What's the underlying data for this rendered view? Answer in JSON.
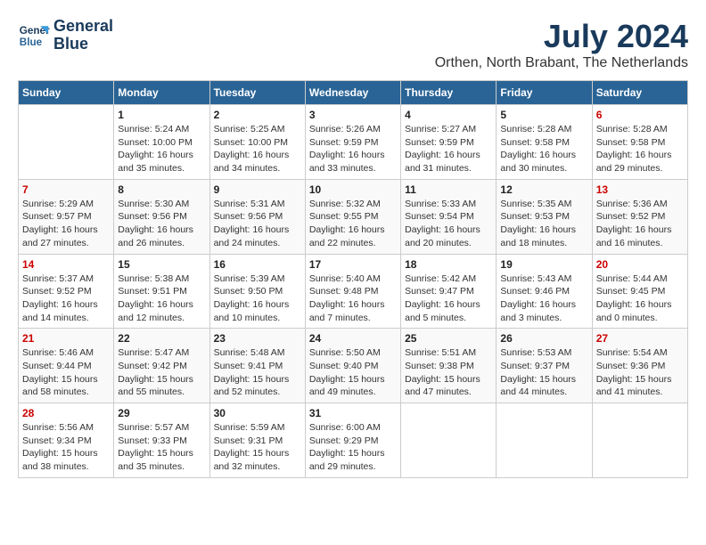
{
  "logo": {
    "line1": "General",
    "line2": "Blue"
  },
  "title": "July 2024",
  "location": "Orthen, North Brabant, The Netherlands",
  "days_of_week": [
    "Sunday",
    "Monday",
    "Tuesday",
    "Wednesday",
    "Thursday",
    "Friday",
    "Saturday"
  ],
  "weeks": [
    [
      {
        "day": "",
        "info": ""
      },
      {
        "day": "1",
        "info": "Sunrise: 5:24 AM\nSunset: 10:00 PM\nDaylight: 16 hours\nand 35 minutes."
      },
      {
        "day": "2",
        "info": "Sunrise: 5:25 AM\nSunset: 10:00 PM\nDaylight: 16 hours\nand 34 minutes."
      },
      {
        "day": "3",
        "info": "Sunrise: 5:26 AM\nSunset: 9:59 PM\nDaylight: 16 hours\nand 33 minutes."
      },
      {
        "day": "4",
        "info": "Sunrise: 5:27 AM\nSunset: 9:59 PM\nDaylight: 16 hours\nand 31 minutes."
      },
      {
        "day": "5",
        "info": "Sunrise: 5:28 AM\nSunset: 9:58 PM\nDaylight: 16 hours\nand 30 minutes."
      },
      {
        "day": "6",
        "info": "Sunrise: 5:28 AM\nSunset: 9:58 PM\nDaylight: 16 hours\nand 29 minutes."
      }
    ],
    [
      {
        "day": "7",
        "info": "Sunrise: 5:29 AM\nSunset: 9:57 PM\nDaylight: 16 hours\nand 27 minutes."
      },
      {
        "day": "8",
        "info": "Sunrise: 5:30 AM\nSunset: 9:56 PM\nDaylight: 16 hours\nand 26 minutes."
      },
      {
        "day": "9",
        "info": "Sunrise: 5:31 AM\nSunset: 9:56 PM\nDaylight: 16 hours\nand 24 minutes."
      },
      {
        "day": "10",
        "info": "Sunrise: 5:32 AM\nSunset: 9:55 PM\nDaylight: 16 hours\nand 22 minutes."
      },
      {
        "day": "11",
        "info": "Sunrise: 5:33 AM\nSunset: 9:54 PM\nDaylight: 16 hours\nand 20 minutes."
      },
      {
        "day": "12",
        "info": "Sunrise: 5:35 AM\nSunset: 9:53 PM\nDaylight: 16 hours\nand 18 minutes."
      },
      {
        "day": "13",
        "info": "Sunrise: 5:36 AM\nSunset: 9:52 PM\nDaylight: 16 hours\nand 16 minutes."
      }
    ],
    [
      {
        "day": "14",
        "info": "Sunrise: 5:37 AM\nSunset: 9:52 PM\nDaylight: 16 hours\nand 14 minutes."
      },
      {
        "day": "15",
        "info": "Sunrise: 5:38 AM\nSunset: 9:51 PM\nDaylight: 16 hours\nand 12 minutes."
      },
      {
        "day": "16",
        "info": "Sunrise: 5:39 AM\nSunset: 9:50 PM\nDaylight: 16 hours\nand 10 minutes."
      },
      {
        "day": "17",
        "info": "Sunrise: 5:40 AM\nSunset: 9:48 PM\nDaylight: 16 hours\nand 7 minutes."
      },
      {
        "day": "18",
        "info": "Sunrise: 5:42 AM\nSunset: 9:47 PM\nDaylight: 16 hours\nand 5 minutes."
      },
      {
        "day": "19",
        "info": "Sunrise: 5:43 AM\nSunset: 9:46 PM\nDaylight: 16 hours\nand 3 minutes."
      },
      {
        "day": "20",
        "info": "Sunrise: 5:44 AM\nSunset: 9:45 PM\nDaylight: 16 hours\nand 0 minutes."
      }
    ],
    [
      {
        "day": "21",
        "info": "Sunrise: 5:46 AM\nSunset: 9:44 PM\nDaylight: 15 hours\nand 58 minutes."
      },
      {
        "day": "22",
        "info": "Sunrise: 5:47 AM\nSunset: 9:42 PM\nDaylight: 15 hours\nand 55 minutes."
      },
      {
        "day": "23",
        "info": "Sunrise: 5:48 AM\nSunset: 9:41 PM\nDaylight: 15 hours\nand 52 minutes."
      },
      {
        "day": "24",
        "info": "Sunrise: 5:50 AM\nSunset: 9:40 PM\nDaylight: 15 hours\nand 49 minutes."
      },
      {
        "day": "25",
        "info": "Sunrise: 5:51 AM\nSunset: 9:38 PM\nDaylight: 15 hours\nand 47 minutes."
      },
      {
        "day": "26",
        "info": "Sunrise: 5:53 AM\nSunset: 9:37 PM\nDaylight: 15 hours\nand 44 minutes."
      },
      {
        "day": "27",
        "info": "Sunrise: 5:54 AM\nSunset: 9:36 PM\nDaylight: 15 hours\nand 41 minutes."
      }
    ],
    [
      {
        "day": "28",
        "info": "Sunrise: 5:56 AM\nSunset: 9:34 PM\nDaylight: 15 hours\nand 38 minutes."
      },
      {
        "day": "29",
        "info": "Sunrise: 5:57 AM\nSunset: 9:33 PM\nDaylight: 15 hours\nand 35 minutes."
      },
      {
        "day": "30",
        "info": "Sunrise: 5:59 AM\nSunset: 9:31 PM\nDaylight: 15 hours\nand 32 minutes."
      },
      {
        "day": "31",
        "info": "Sunrise: 6:00 AM\nSunset: 9:29 PM\nDaylight: 15 hours\nand 29 minutes."
      },
      {
        "day": "",
        "info": ""
      },
      {
        "day": "",
        "info": ""
      },
      {
        "day": "",
        "info": ""
      }
    ]
  ]
}
